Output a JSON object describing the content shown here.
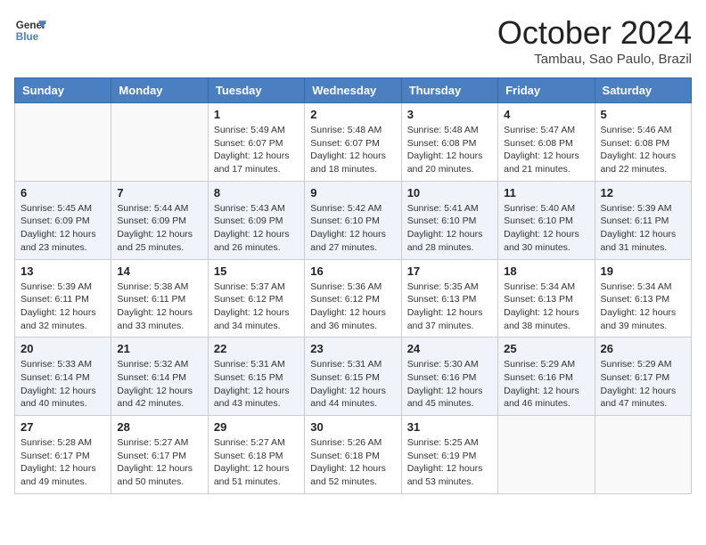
{
  "header": {
    "logo_line1": "General",
    "logo_line2": "Blue",
    "month_title": "October 2024",
    "location": "Tambau, Sao Paulo, Brazil"
  },
  "weekdays": [
    "Sunday",
    "Monday",
    "Tuesday",
    "Wednesday",
    "Thursday",
    "Friday",
    "Saturday"
  ],
  "weeks": [
    [
      {
        "day": "",
        "info": ""
      },
      {
        "day": "",
        "info": ""
      },
      {
        "day": "1",
        "info": "Sunrise: 5:49 AM\nSunset: 6:07 PM\nDaylight: 12 hours and 17 minutes."
      },
      {
        "day": "2",
        "info": "Sunrise: 5:48 AM\nSunset: 6:07 PM\nDaylight: 12 hours and 18 minutes."
      },
      {
        "day": "3",
        "info": "Sunrise: 5:48 AM\nSunset: 6:08 PM\nDaylight: 12 hours and 20 minutes."
      },
      {
        "day": "4",
        "info": "Sunrise: 5:47 AM\nSunset: 6:08 PM\nDaylight: 12 hours and 21 minutes."
      },
      {
        "day": "5",
        "info": "Sunrise: 5:46 AM\nSunset: 6:08 PM\nDaylight: 12 hours and 22 minutes."
      }
    ],
    [
      {
        "day": "6",
        "info": "Sunrise: 5:45 AM\nSunset: 6:09 PM\nDaylight: 12 hours and 23 minutes."
      },
      {
        "day": "7",
        "info": "Sunrise: 5:44 AM\nSunset: 6:09 PM\nDaylight: 12 hours and 25 minutes."
      },
      {
        "day": "8",
        "info": "Sunrise: 5:43 AM\nSunset: 6:09 PM\nDaylight: 12 hours and 26 minutes."
      },
      {
        "day": "9",
        "info": "Sunrise: 5:42 AM\nSunset: 6:10 PM\nDaylight: 12 hours and 27 minutes."
      },
      {
        "day": "10",
        "info": "Sunrise: 5:41 AM\nSunset: 6:10 PM\nDaylight: 12 hours and 28 minutes."
      },
      {
        "day": "11",
        "info": "Sunrise: 5:40 AM\nSunset: 6:10 PM\nDaylight: 12 hours and 30 minutes."
      },
      {
        "day": "12",
        "info": "Sunrise: 5:39 AM\nSunset: 6:11 PM\nDaylight: 12 hours and 31 minutes."
      }
    ],
    [
      {
        "day": "13",
        "info": "Sunrise: 5:39 AM\nSunset: 6:11 PM\nDaylight: 12 hours and 32 minutes."
      },
      {
        "day": "14",
        "info": "Sunrise: 5:38 AM\nSunset: 6:11 PM\nDaylight: 12 hours and 33 minutes."
      },
      {
        "day": "15",
        "info": "Sunrise: 5:37 AM\nSunset: 6:12 PM\nDaylight: 12 hours and 34 minutes."
      },
      {
        "day": "16",
        "info": "Sunrise: 5:36 AM\nSunset: 6:12 PM\nDaylight: 12 hours and 36 minutes."
      },
      {
        "day": "17",
        "info": "Sunrise: 5:35 AM\nSunset: 6:13 PM\nDaylight: 12 hours and 37 minutes."
      },
      {
        "day": "18",
        "info": "Sunrise: 5:34 AM\nSunset: 6:13 PM\nDaylight: 12 hours and 38 minutes."
      },
      {
        "day": "19",
        "info": "Sunrise: 5:34 AM\nSunset: 6:13 PM\nDaylight: 12 hours and 39 minutes."
      }
    ],
    [
      {
        "day": "20",
        "info": "Sunrise: 5:33 AM\nSunset: 6:14 PM\nDaylight: 12 hours and 40 minutes."
      },
      {
        "day": "21",
        "info": "Sunrise: 5:32 AM\nSunset: 6:14 PM\nDaylight: 12 hours and 42 minutes."
      },
      {
        "day": "22",
        "info": "Sunrise: 5:31 AM\nSunset: 6:15 PM\nDaylight: 12 hours and 43 minutes."
      },
      {
        "day": "23",
        "info": "Sunrise: 5:31 AM\nSunset: 6:15 PM\nDaylight: 12 hours and 44 minutes."
      },
      {
        "day": "24",
        "info": "Sunrise: 5:30 AM\nSunset: 6:16 PM\nDaylight: 12 hours and 45 minutes."
      },
      {
        "day": "25",
        "info": "Sunrise: 5:29 AM\nSunset: 6:16 PM\nDaylight: 12 hours and 46 minutes."
      },
      {
        "day": "26",
        "info": "Sunrise: 5:29 AM\nSunset: 6:17 PM\nDaylight: 12 hours and 47 minutes."
      }
    ],
    [
      {
        "day": "27",
        "info": "Sunrise: 5:28 AM\nSunset: 6:17 PM\nDaylight: 12 hours and 49 minutes."
      },
      {
        "day": "28",
        "info": "Sunrise: 5:27 AM\nSunset: 6:17 PM\nDaylight: 12 hours and 50 minutes."
      },
      {
        "day": "29",
        "info": "Sunrise: 5:27 AM\nSunset: 6:18 PM\nDaylight: 12 hours and 51 minutes."
      },
      {
        "day": "30",
        "info": "Sunrise: 5:26 AM\nSunset: 6:18 PM\nDaylight: 12 hours and 52 minutes."
      },
      {
        "day": "31",
        "info": "Sunrise: 5:25 AM\nSunset: 6:19 PM\nDaylight: 12 hours and 53 minutes."
      },
      {
        "day": "",
        "info": ""
      },
      {
        "day": "",
        "info": ""
      }
    ]
  ]
}
